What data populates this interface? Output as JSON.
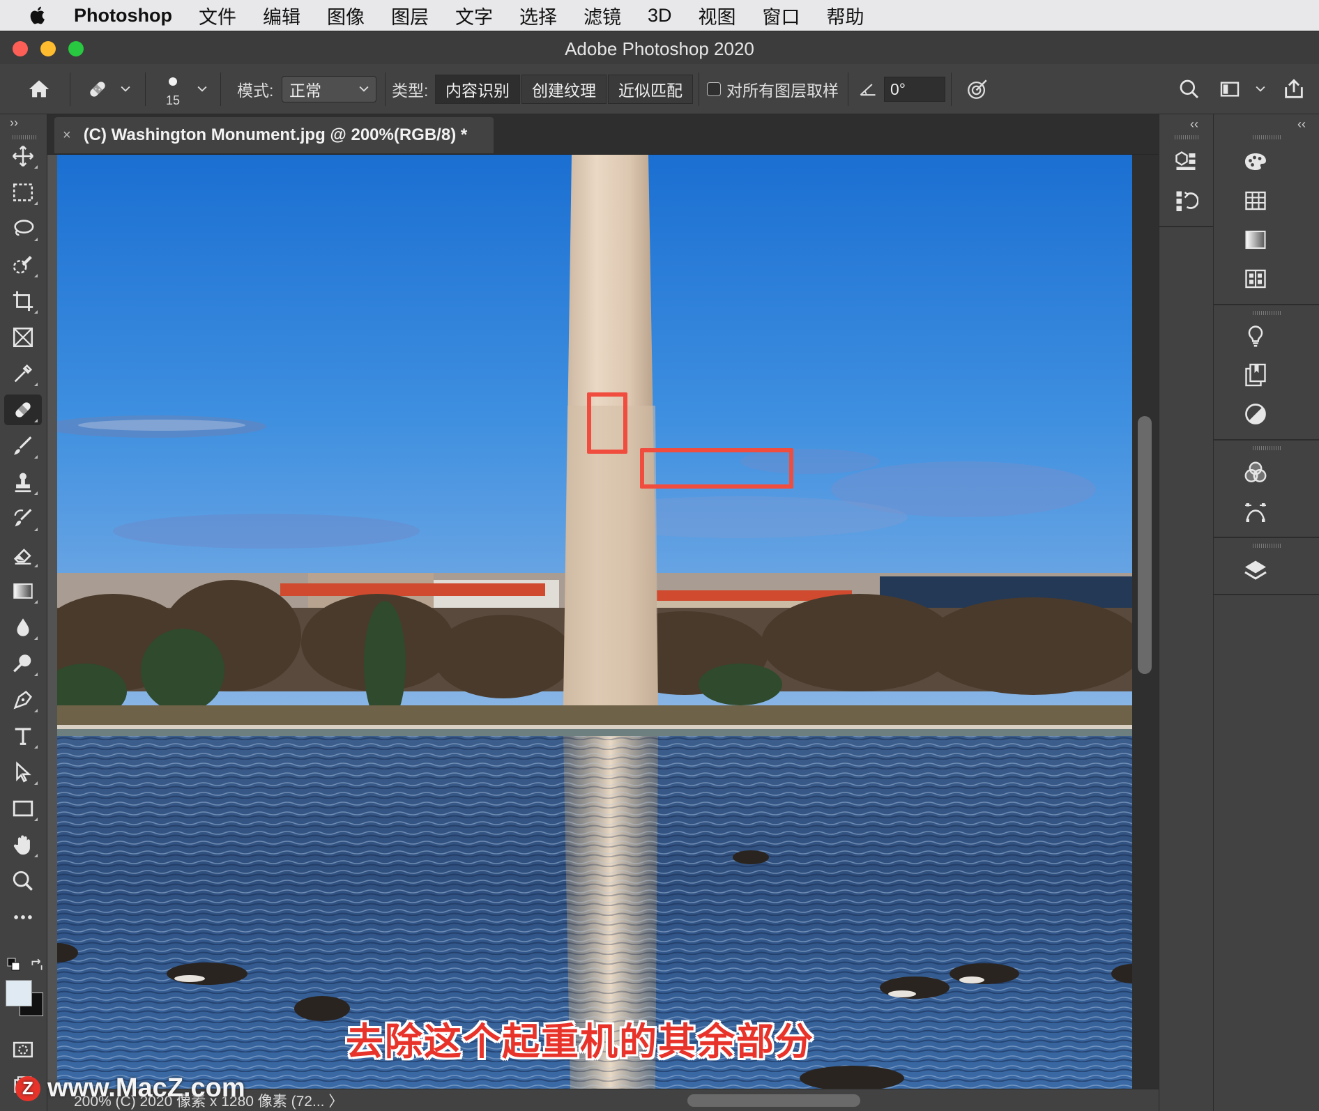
{
  "menubar": {
    "app_name": "Photoshop",
    "items": [
      "文件",
      "编辑",
      "图像",
      "图层",
      "文字",
      "选择",
      "滤镜",
      "3D",
      "视图",
      "窗口",
      "帮助"
    ]
  },
  "window": {
    "title": "Adobe Photoshop 2020"
  },
  "options": {
    "brush_size": "15",
    "mode_label": "模式:",
    "mode_value": "正常",
    "type_label": "类型:",
    "type_options": [
      "内容识别",
      "创建纹理",
      "近似匹配"
    ],
    "type_selected": 0,
    "sample_all_layers_label": "对所有图层取样",
    "sample_all_layers_checked": false,
    "angle_value": "0°"
  },
  "document": {
    "tab_title": "(C) Washington Monument.jpg @ 200%(RGB/8) *",
    "close_glyph": "×"
  },
  "tools": [
    "move-tool-icon",
    "marquee-tool-icon",
    "lasso-tool-icon",
    "quick-select-tool-icon",
    "crop-tool-icon",
    "frame-tool-icon",
    "eyedropper-tool-icon",
    "spot-healing-tool-icon",
    "brush-tool-icon",
    "clone-stamp-tool-icon",
    "history-brush-tool-icon",
    "eraser-tool-icon",
    "gradient-tool-icon",
    "blur-tool-icon",
    "dodge-tool-icon",
    "pen-tool-icon",
    "type-tool-icon",
    "path-select-tool-icon",
    "rectangle-tool-icon",
    "hand-tool-icon",
    "zoom-tool-icon",
    "more-tools-icon"
  ],
  "selected_tool": 7,
  "status": {
    "text": "200%   (C) 2020 像素 x 1280 像素 (72...  〉"
  },
  "caption": "去除这个起重机的其余部分",
  "watermark": "www.MacZ.com",
  "colors": {
    "annotation_red": "#f04d3f",
    "foreground": "#dfeaf2",
    "background": "#111111"
  },
  "right_panels": {
    "strip1_icons": [
      "3d-panel-icon",
      "history-panel-icon"
    ],
    "strip2_icons": [
      "color-panel-icon",
      "swatches-panel-icon",
      "gradients-panel-icon",
      "patterns-panel-icon",
      "learn-panel-icon",
      "libraries-panel-icon",
      "adjustments-panel-icon",
      "channels-panel-icon",
      "paths-panel-icon",
      "layers-panel-icon"
    ]
  }
}
